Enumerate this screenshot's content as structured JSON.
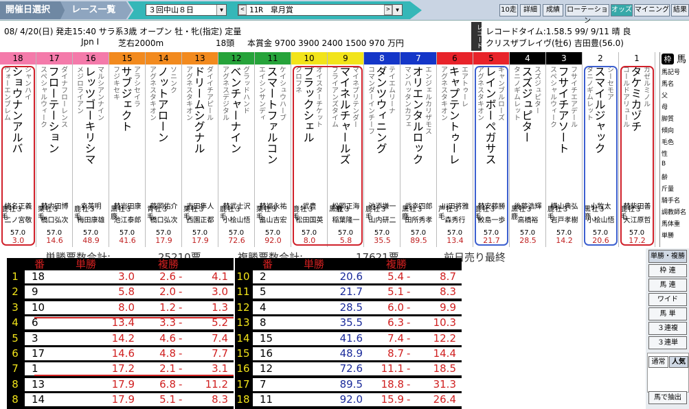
{
  "toolbar": {
    "crumb1": "開催日選択",
    "crumb2": "レース一覧",
    "day": "３回中山８日",
    "race": "11R　皐月賞",
    "btns": [
      "10走",
      "詳細",
      "成績",
      "ローテーション",
      "オッズ",
      "マイニング",
      "結果"
    ]
  },
  "info": {
    "line1": "08/ 4/20(日) 発走15:40 サラ系3歳 オープン 牡・牝(指定) 定量",
    "grade": "Jpn I",
    "course": "芝右2000m",
    "heads": "18頭",
    "prize": "本賞金 9700 3900 2400 1500 970 万円",
    "tate": "レコード",
    "record1": "レコードタイム:1.58.5 99/ 9/11 晴 良",
    "record2": "クリスザブレイヴ(牡6) 吉田豊(56.0)"
  },
  "horses": [
    {
      "no": "18",
      "frame": "8",
      "sire": "シャンハイ",
      "dam": "ウォーエンブレム",
      "name": "ショウナンアルバ",
      "s1": "鹿",
      "s2": "毛",
      "sex": "牡３",
      "wt": "57.0",
      "jockey": "蛯名正義",
      "trainer": "二ノ宮敬",
      "odds": "3.0"
    },
    {
      "no": "17",
      "frame": "8",
      "sire": "ダイナフローレンス",
      "dam": "スペシャルウィーク",
      "name": "フローテーション",
      "s1": "栗",
      "s2": "毛",
      "sex": "牡３",
      "wt": "57.0",
      "jockey": "替内田博",
      "trainer": "橋口弘次",
      "odds": "14.6"
    },
    {
      "no": "16",
      "frame": "8",
      "sire": "マルシアンナイン",
      "dam": "メジロライアン",
      "name": "レッツゴーキリシマ",
      "s1": "鹿",
      "s2": "毛",
      "sex": "牡３",
      "wt": "57.0",
      "jockey": "幸英明",
      "trainer": "梅田康雄",
      "odds": "48.9"
    },
    {
      "no": "15",
      "frame": "7",
      "sire": "アラシセイラ",
      "dam": "フジキセキ",
      "name": "サブジェクト",
      "s1": "黒",
      "s2": "鹿",
      "sex": "牡３",
      "wt": "57.0",
      "jockey": "替岩田康",
      "trainer": "池江泰郎",
      "odds": "41.6"
    },
    {
      "no": "14",
      "frame": "7",
      "sire": "ソニンク",
      "dam": "アグネスタキオン",
      "name": "ノットアローン",
      "s1": "青",
      "s2": "毛",
      "sex": "牡３",
      "wt": "57.0",
      "jockey": "藤岡佑介",
      "trainer": "橋口弘次",
      "odds": "17.9"
    },
    {
      "no": "13",
      "frame": "7",
      "sire": "ダイイチアピール",
      "dam": "アグネスタキオン",
      "name": "ドリームシグナル",
      "s1": "栗",
      "s2": "毛",
      "sex": "牡３",
      "wt": "57.0",
      "jockey": "吉田隼人",
      "trainer": "西園正都",
      "odds": "17.9"
    },
    {
      "no": "12",
      "frame": "6",
      "sire": "グラッドハンド",
      "dam": "アグネスデジタル",
      "name": "ベンチャーナイン",
      "s1": "鹿",
      "s2": "毛",
      "sex": "牡３",
      "wt": "57.0",
      "jockey": "替武士沢",
      "trainer": "小桧山悟",
      "odds": "72.6"
    },
    {
      "no": "11",
      "frame": "6",
      "sire": "ケイシュウハーブ",
      "dam": "エイシンサンディ",
      "name": "スマートファルコン",
      "s1": "栗",
      "s2": "毛",
      "sex": "牡３",
      "wt": "57.0",
      "jockey": "替福永祐",
      "trainer": "畠山吉宏",
      "odds": "92.0"
    },
    {
      "no": "10",
      "frame": "5",
      "sire": "オイスターチケット",
      "dam": "クロフネ",
      "name": "ブラックシェル",
      "s1": "鹿",
      "s2": "毛",
      "sex": "牡３",
      "wt": "57.0",
      "jockey": "武豊",
      "trainer": "松田国英",
      "odds": "8.0"
    },
    {
      "no": "9",
      "frame": "5",
      "sire": "マイネプリテンダー",
      "dam": "ブライアンズタイム",
      "name": "マイネルチャールズ",
      "s1": "黒鹿",
      "s2": "",
      "sex": "牡３",
      "wt": "57.0",
      "jockey": "松岡正海",
      "trainer": "稲葉隆一",
      "odds": "5.8"
    },
    {
      "no": "8",
      "frame": "4",
      "sire": "テイエムリーナ",
      "dam": "コマンダーインチーフ",
      "name": "ダンツウィニング",
      "s1": "鹿",
      "s2": "毛",
      "sex": "牡３",
      "wt": "57.0",
      "jockey": "池添謙一",
      "trainer": "山内研二",
      "odds": "35.5"
    },
    {
      "no": "7",
      "frame": "4",
      "sire": "エンジェルカリザモス",
      "dam": "マンハッタンカフェ",
      "name": "オリエンタルロック",
      "s1": "黒",
      "s2": "鹿",
      "sex": "牡３",
      "wt": "57.0",
      "jockey": "武幸四郎",
      "trainer": "田所秀孝",
      "odds": "89.5"
    },
    {
      "no": "6",
      "frame": "3",
      "sire": "エアトゥーレ",
      "dam": "アグネスタキオン",
      "name": "キャプテントゥーレ",
      "s1": "芦",
      "s2": "毛",
      "sex": "牡３",
      "wt": "57.0",
      "jockey": "川田将雅",
      "trainer": "森秀行",
      "odds": "13.4"
    },
    {
      "no": "5",
      "frame": "3",
      "sire": "ギャンブルローズ",
      "dam": "アグネスタキオン",
      "name": "レインボーペガサス",
      "s1": "鹿",
      "s2": "毛",
      "sex": "牡３",
      "wt": "57.0",
      "jockey": "替安藤勝",
      "trainer": "鮫島一歩",
      "odds": "21.7"
    },
    {
      "no": "4",
      "frame": "2",
      "sire": "スズジュピター",
      "dam": "タニノギムレット",
      "name": "スズジュピター",
      "s1": "黒",
      "s2": "鹿",
      "sex": "牡３",
      "wt": "57.0",
      "jockey": "後藤浩輝",
      "trainer": "高橋裕",
      "odds": "28.5"
    },
    {
      "no": "3",
      "frame": "2",
      "sire": "フサイチエアデール",
      "dam": "スペシャルウィーク",
      "name": "フサイチアソート",
      "s1": "鹿",
      "s2": "毛",
      "sex": "牡３",
      "wt": "57.0",
      "jockey": "横山典弘",
      "trainer": "岩戸孝樹",
      "odds": "14.2"
    },
    {
      "no": "2",
      "frame": "1",
      "sire": "シーセモア",
      "dam": "タニノギムレット",
      "name": "スマイルジャック",
      "s1": "黒",
      "s2": "鹿",
      "sex": "牡３",
      "wt": "57.0",
      "jockey": "小牧太",
      "trainer": "小桧山悟",
      "odds": "20.6"
    },
    {
      "no": "1",
      "frame": "1",
      "sire": "ガゼルミノル",
      "dam": "ゴールドアリュール",
      "name": "タケミカヅチ",
      "s1": "鹿",
      "s2": "毛",
      "sex": "牡３",
      "wt": "57.0",
      "jockey": "替柴田善",
      "trainer": "大江原哲",
      "odds": "17.2"
    }
  ],
  "side": {
    "top": "馬",
    "labels": [
      "馬記号",
      "馬名",
      "父",
      "母",
      "脚質",
      "傾向",
      "毛色",
      "性",
      "B",
      "齢",
      "斤量",
      "騎手名",
      "調教師名",
      "馬体重",
      "単勝"
    ]
  },
  "totals": {
    "t1": "単勝票数合計:",
    "v1": "25210票",
    "t2": "複勝票数合計:",
    "v2": "17621票",
    "t3": "前日売り最終"
  },
  "table_head": {
    "ban": "番",
    "tan": "単勝",
    "fuku": "複勝"
  },
  "left_rows": [
    {
      "wk": "1",
      "no": "18",
      "win": "3.0",
      "pmin": "2.6",
      "pmax": "4.1"
    },
    {
      "wk": "2",
      "no": "9",
      "win": "5.8",
      "pmin": "2.0",
      "pmax": "3.0"
    },
    {
      "wk": "3",
      "no": "10",
      "win": "8.0",
      "pmin": "1.2",
      "pmax": "1.3"
    },
    {
      "wk": "4",
      "no": "6",
      "win": "13.4",
      "pmin": "3.3",
      "pmax": "5.2"
    },
    {
      "wk": "5",
      "no": "3",
      "win": "14.2",
      "pmin": "4.6",
      "pmax": "7.4"
    },
    {
      "wk": "6",
      "no": "17",
      "win": "14.6",
      "pmin": "4.8",
      "pmax": "7.7"
    },
    {
      "wk": "7",
      "no": "1",
      "win": "17.2",
      "pmin": "2.1",
      "pmax": "3.1"
    },
    {
      "wk": "8",
      "no": "13",
      "win": "17.9",
      "pmin": "6.8",
      "pmax": "11.2"
    },
    {
      "wk": "8",
      "no": "14",
      "win": "17.9",
      "pmin": "5.1",
      "pmax": "8.3"
    }
  ],
  "right_rows": [
    {
      "wk": "10",
      "no": "2",
      "win": "20.6",
      "pmin": "5.4",
      "pmax": "8.7"
    },
    {
      "wk": "11",
      "no": "5",
      "win": "21.7",
      "pmin": "5.1",
      "pmax": "8.3"
    },
    {
      "wk": "12",
      "no": "4",
      "win": "28.5",
      "pmin": "6.0",
      "pmax": "9.9"
    },
    {
      "wk": "13",
      "no": "8",
      "win": "35.5",
      "pmin": "6.3",
      "pmax": "10.3"
    },
    {
      "wk": "14",
      "no": "15",
      "win": "41.6",
      "pmin": "7.4",
      "pmax": "12.2"
    },
    {
      "wk": "15",
      "no": "16",
      "win": "48.9",
      "pmin": "8.7",
      "pmax": "14.4"
    },
    {
      "wk": "16",
      "no": "12",
      "win": "72.6",
      "pmin": "11.1",
      "pmax": "18.5"
    },
    {
      "wk": "17",
      "no": "7",
      "win": "89.5",
      "pmin": "18.8",
      "pmax": "31.3"
    },
    {
      "wk": "18",
      "no": "11",
      "win": "92.0",
      "pmin": "15.9",
      "pmax": "26.4"
    }
  ],
  "rbtns": [
    "単勝・複勝",
    "枠 連",
    "馬 連",
    "ワイド",
    "馬 単",
    "３連複",
    "３連単"
  ],
  "mode": [
    "通常",
    "人気"
  ],
  "extract": "馬で抽出",
  "colors": {
    "f1": "#ffffff",
    "f2": "#000000",
    "f3": "#e8232a",
    "f4": "#1436c8",
    "f5": "#f2e41a",
    "f6": "#26a33a",
    "f7": "#f28a1e",
    "f8": "#f47aaa"
  }
}
